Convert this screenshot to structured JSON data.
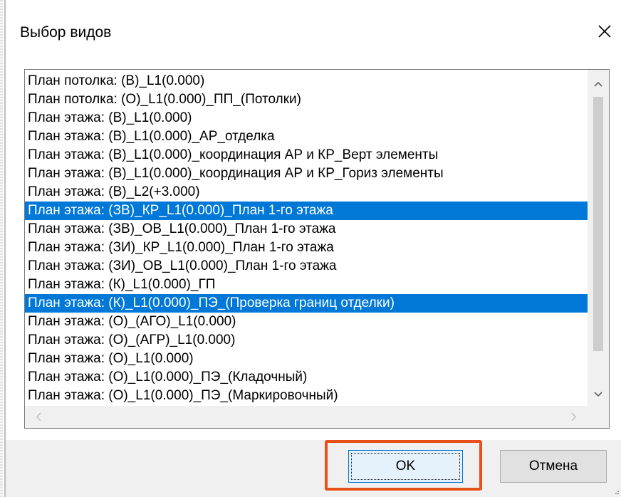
{
  "window": {
    "title": "Выбор видов"
  },
  "icons": {
    "close": "close-icon",
    "scroll_up": "chevron-up-icon",
    "scroll_down": "chevron-down-icon",
    "scroll_left": "chevron-left-icon",
    "scroll_right": "chevron-right-icon",
    "resize_grip": "resize-grip-icon"
  },
  "colors": {
    "selection": "#0078d7",
    "highlight_frame": "#e8501a",
    "button_focus_border": "#0078d7"
  },
  "list": {
    "items": [
      {
        "label": "План потолка: (В)_L1(0.000)",
        "selected": false
      },
      {
        "label": "План потолка: (О)_L1(0.000)_ПП_(Потолки)",
        "selected": false
      },
      {
        "label": "План этажа: (В)_L1(0.000)",
        "selected": false
      },
      {
        "label": "План этажа: (В)_L1(0.000)_АР_отделка",
        "selected": false
      },
      {
        "label": "План этажа: (В)_L1(0.000)_координация АР и КР_Верт элементы",
        "selected": false
      },
      {
        "label": "План этажа: (В)_L1(0.000)_координация АР и КР_Гориз элементы",
        "selected": false
      },
      {
        "label": "План этажа: (В)_L2(+3.000)",
        "selected": false
      },
      {
        "label": "План этажа: (ЗВ)_КР_L1(0.000)_План 1-го этажа",
        "selected": true
      },
      {
        "label": "План этажа: (ЗВ)_ОВ_L1(0.000)_План 1-го этажа",
        "selected": false
      },
      {
        "label": "План этажа: (ЗИ)_КР_L1(0.000)_План 1-го этажа",
        "selected": false
      },
      {
        "label": "План этажа: (ЗИ)_ОВ_L1(0.000)_План 1-го этажа",
        "selected": false
      },
      {
        "label": "План этажа: (К)_L1(0.000)_ГП",
        "selected": false
      },
      {
        "label": "План этажа: (К)_L1(0.000)_ПЭ_(Проверка границ отделки)",
        "selected": true
      },
      {
        "label": "План этажа: (О)_(АГО)_L1(0.000)",
        "selected": false
      },
      {
        "label": "План этажа: (О)_(АГР)_L1(0.000)",
        "selected": false
      },
      {
        "label": "План этажа: (О)_L1(0.000)",
        "selected": false
      },
      {
        "label": "План этажа: (О)_L1(0.000)_ПЭ_(Кладочный)",
        "selected": false
      },
      {
        "label": "План этажа: (О)_L1(0.000)_ПЭ_(Маркировочный)",
        "selected": false
      }
    ]
  },
  "buttons": {
    "ok_label": "OK",
    "cancel_label": "Отмена"
  }
}
